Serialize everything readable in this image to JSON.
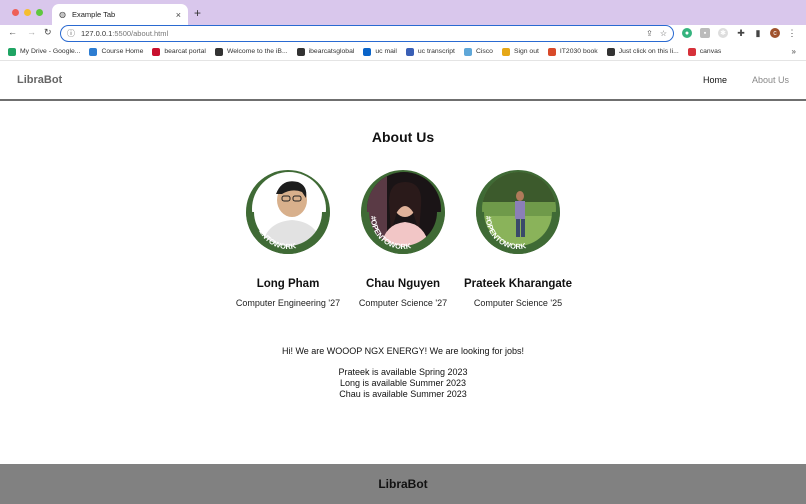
{
  "browser": {
    "tab_title": "Example Tab",
    "tab_close": "×",
    "new_tab": "+",
    "url_host": "127.0.0.1",
    "url_path": ":5500/about.html",
    "bookmarks": [
      {
        "label": "My Drive - Google...",
        "color": "#1fa463"
      },
      {
        "label": "Course Home",
        "color": "#2d7dd2"
      },
      {
        "label": "bearcat portal",
        "color": "#c8102e"
      },
      {
        "label": "Welcome to the iB...",
        "color": "#333333"
      },
      {
        "label": "ibearcatsglobal",
        "color": "#333333"
      },
      {
        "label": "uc mail",
        "color": "#0a64c9"
      },
      {
        "label": "uc transcript",
        "color": "#3a5fb5"
      },
      {
        "label": "Cisco",
        "color": "#5fa7d8"
      },
      {
        "label": "Sign out",
        "color": "#e6a817"
      },
      {
        "label": "IT2030 book",
        "color": "#d84a2a"
      },
      {
        "label": "Just click on this li...",
        "color": "#333333"
      },
      {
        "label": "canvas",
        "color": "#d6313a"
      }
    ],
    "more": "»"
  },
  "site": {
    "brand": "LibraBot",
    "nav": {
      "home": "Home",
      "about": "About Us"
    },
    "title": "About Us",
    "team": [
      {
        "name": "Long Pham",
        "program": "Computer Engineering '27",
        "badge": "#OPENTOWORK"
      },
      {
        "name": "Chau Nguyen",
        "program": "Computer Science '27",
        "badge": "#OPENTOWORK"
      },
      {
        "name": "Prateek Kharangate",
        "program": "Computer Science '25",
        "badge": "#OPENTOWORK"
      }
    ],
    "intro": "Hi! We are WOOOP NGX ENERGY! We are looking for jobs!",
    "availability": [
      "Prateek is available Spring 2023",
      "Long is available Summer 2023",
      "Chau is available Summer 2023"
    ],
    "footer_brand": "LibraBot"
  },
  "colors": {
    "tab_bar": "#d9c7ec",
    "opentowork_green": "#3f6a35",
    "footer_bg": "#818181",
    "omnibox_border": "#2a6ad1"
  }
}
